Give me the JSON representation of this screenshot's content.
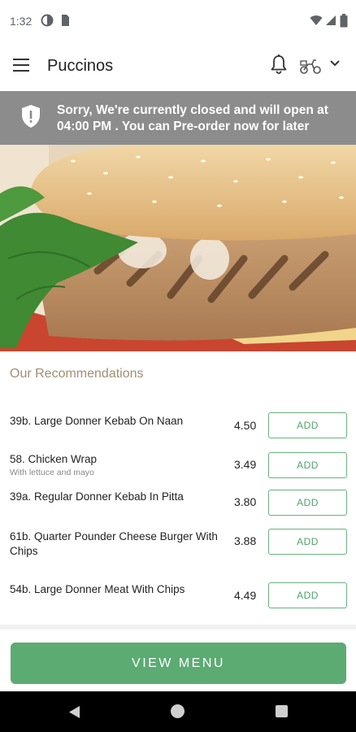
{
  "status_bar": {
    "time": "1:32"
  },
  "app_bar": {
    "title": "Puccinos"
  },
  "banner": {
    "message": "Sorry, We're currently closed and will open at 04:00 PM . You can Pre-order now for later"
  },
  "recommendations": {
    "title": "Our Recommendations",
    "items": [
      {
        "name": "39b. Large Donner Kebab On Naan",
        "description": "",
        "price": "4.50",
        "add_label": "ADD"
      },
      {
        "name": "58. Chicken Wrap",
        "description": "With lettuce and mayo",
        "price": "3.49",
        "add_label": "ADD"
      },
      {
        "name": "39a. Regular Donner Kebab In Pitta",
        "description": "",
        "price": "3.80",
        "add_label": "ADD"
      },
      {
        "name": "61b. Quarter Pounder Cheese Burger With Chips",
        "description": "",
        "price": "3.88",
        "add_label": "ADD"
      },
      {
        "name": "54b. Large Donner Meat With Chips",
        "description": "",
        "price": "4.49",
        "add_label": "ADD"
      }
    ]
  },
  "view_menu_label": "VIEW MENU",
  "colors": {
    "accent": "#5bab72",
    "banner": "#8c8c8c",
    "section_title": "#a08e73"
  },
  "icons": [
    "menu-icon",
    "bell-icon",
    "scooter-icon",
    "chevron-down-icon",
    "shield-icon",
    "back-icon",
    "home-icon",
    "recents-icon"
  ]
}
